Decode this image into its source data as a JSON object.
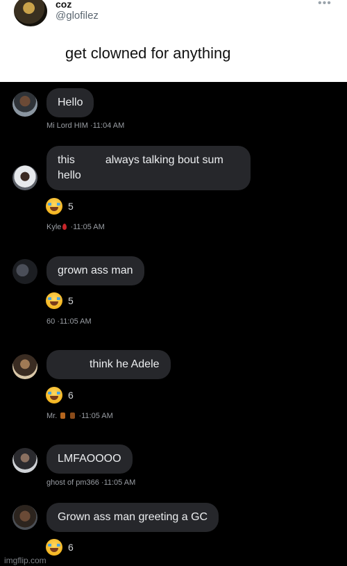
{
  "tweet": {
    "name": "coz",
    "handle": "@glofilez",
    "more": "•••",
    "text": "get clowned for anything"
  },
  "messages": [
    {
      "text": "Hello",
      "sender": "Mi Lord HIM",
      "time": "·11:04 AM",
      "reaction_count": null
    },
    {
      "text_a": "this",
      "text_b": "always talking bout sum",
      "text_c": "hello",
      "sender": "Kyle",
      "time": "·11:05 AM",
      "reaction_count": "5"
    },
    {
      "text": "grown ass man",
      "sender": "60",
      "time": "·11:05 AM",
      "reaction_count": "5"
    },
    {
      "text": "think he Adele",
      "sender": "Mr.",
      "time": "·11:05 AM",
      "reaction_count": "6"
    },
    {
      "text": "LMFAOOOO",
      "sender": "ghost of pm366",
      "time": "·11:05 AM",
      "reaction_count": null
    },
    {
      "text": "Grown ass man greeting a GC",
      "sender": "",
      "time": "",
      "reaction_count": "6"
    }
  ],
  "icons": {
    "reaction": "joy-emoji-icon",
    "avatar": "avatar-photo"
  },
  "colors": {
    "bubble": "#26272b",
    "background": "#000000",
    "meta": "#9a9ea4"
  },
  "watermark": "imgflip.com"
}
